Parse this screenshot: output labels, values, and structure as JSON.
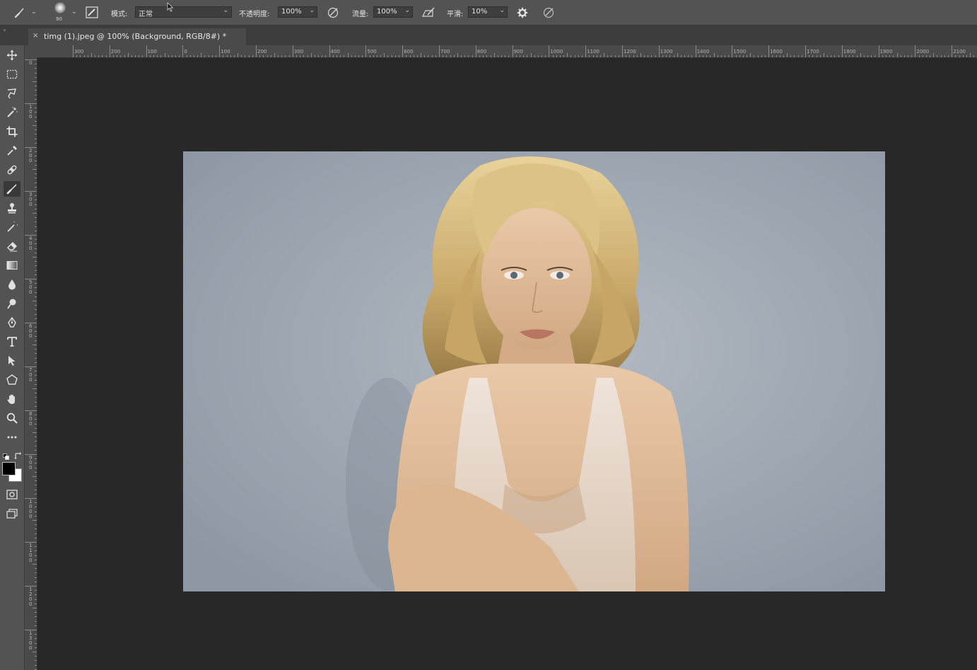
{
  "options_bar": {
    "brush_size": "90",
    "mode_label": "模式:",
    "mode_value": "正常",
    "opacity_label": "不透明度:",
    "opacity_value": "100%",
    "flow_label": "流量:",
    "flow_value": "100%",
    "smoothing_label": "平滑:",
    "smoothing_value": "10%"
  },
  "document_tab": {
    "close_glyph": "×",
    "title": "timg (1).jpeg @ 100% (Background, RGB/8#) *"
  },
  "toolbar": {
    "tools": [
      {
        "name": "move-tool",
        "icon": "move-icon"
      },
      {
        "name": "marquee-tool",
        "icon": "rect-marquee-icon"
      },
      {
        "name": "lasso-tool",
        "icon": "lasso-icon"
      },
      {
        "name": "magic-wand-tool",
        "icon": "magic-wand-icon"
      },
      {
        "name": "crop-tool",
        "icon": "crop-icon"
      },
      {
        "name": "eyedropper-tool",
        "icon": "eyedropper-icon"
      },
      {
        "name": "healing-tool",
        "icon": "bandage-icon"
      },
      {
        "name": "brush-tool",
        "icon": "brush-icon",
        "active": true
      },
      {
        "name": "clone-stamp-tool",
        "icon": "stamp-icon"
      },
      {
        "name": "history-brush-tool",
        "icon": "history-brush-icon"
      },
      {
        "name": "eraser-tool",
        "icon": "eraser-icon"
      },
      {
        "name": "gradient-tool",
        "icon": "gradient-icon"
      },
      {
        "name": "blur-tool",
        "icon": "drop-icon"
      },
      {
        "name": "dodge-tool",
        "icon": "dodge-icon"
      },
      {
        "name": "pen-tool",
        "icon": "pen-icon"
      },
      {
        "name": "type-tool",
        "icon": "type-icon"
      },
      {
        "name": "path-selection-tool",
        "icon": "arrow-icon"
      },
      {
        "name": "shape-tool",
        "icon": "shape-icon"
      },
      {
        "name": "hand-tool",
        "icon": "hand-icon"
      },
      {
        "name": "zoom-tool",
        "icon": "zoom-icon"
      },
      {
        "name": "more-tools",
        "icon": "ellipsis-icon"
      }
    ],
    "foreground_color": "#000000",
    "background_color": "#ffffff"
  },
  "rulers": {
    "horizontal_labels": [
      "300",
      "200",
      "100",
      "0",
      "100",
      "200",
      "300",
      "400",
      "500",
      "600",
      "700",
      "800",
      "900",
      "1000",
      "1100",
      "1200",
      "1300",
      "1400",
      "1500",
      "1600",
      "1700",
      "1800",
      "1900",
      "2000",
      "2100"
    ],
    "vertical_labels": [
      "0",
      "1 0 0",
      "2 0 0",
      "3 0 0",
      "4 0 0",
      "5 0 0",
      "6 0 0",
      "7 0 0",
      "8 0 0",
      "9 0 0",
      "1 0 0 0",
      "1 1 0 0",
      "1 2 0 0",
      "1 3 0 0"
    ]
  },
  "colors": {
    "ui_panel": "#535353",
    "workspace": "#282828",
    "ruler": "#4a4a4a"
  }
}
